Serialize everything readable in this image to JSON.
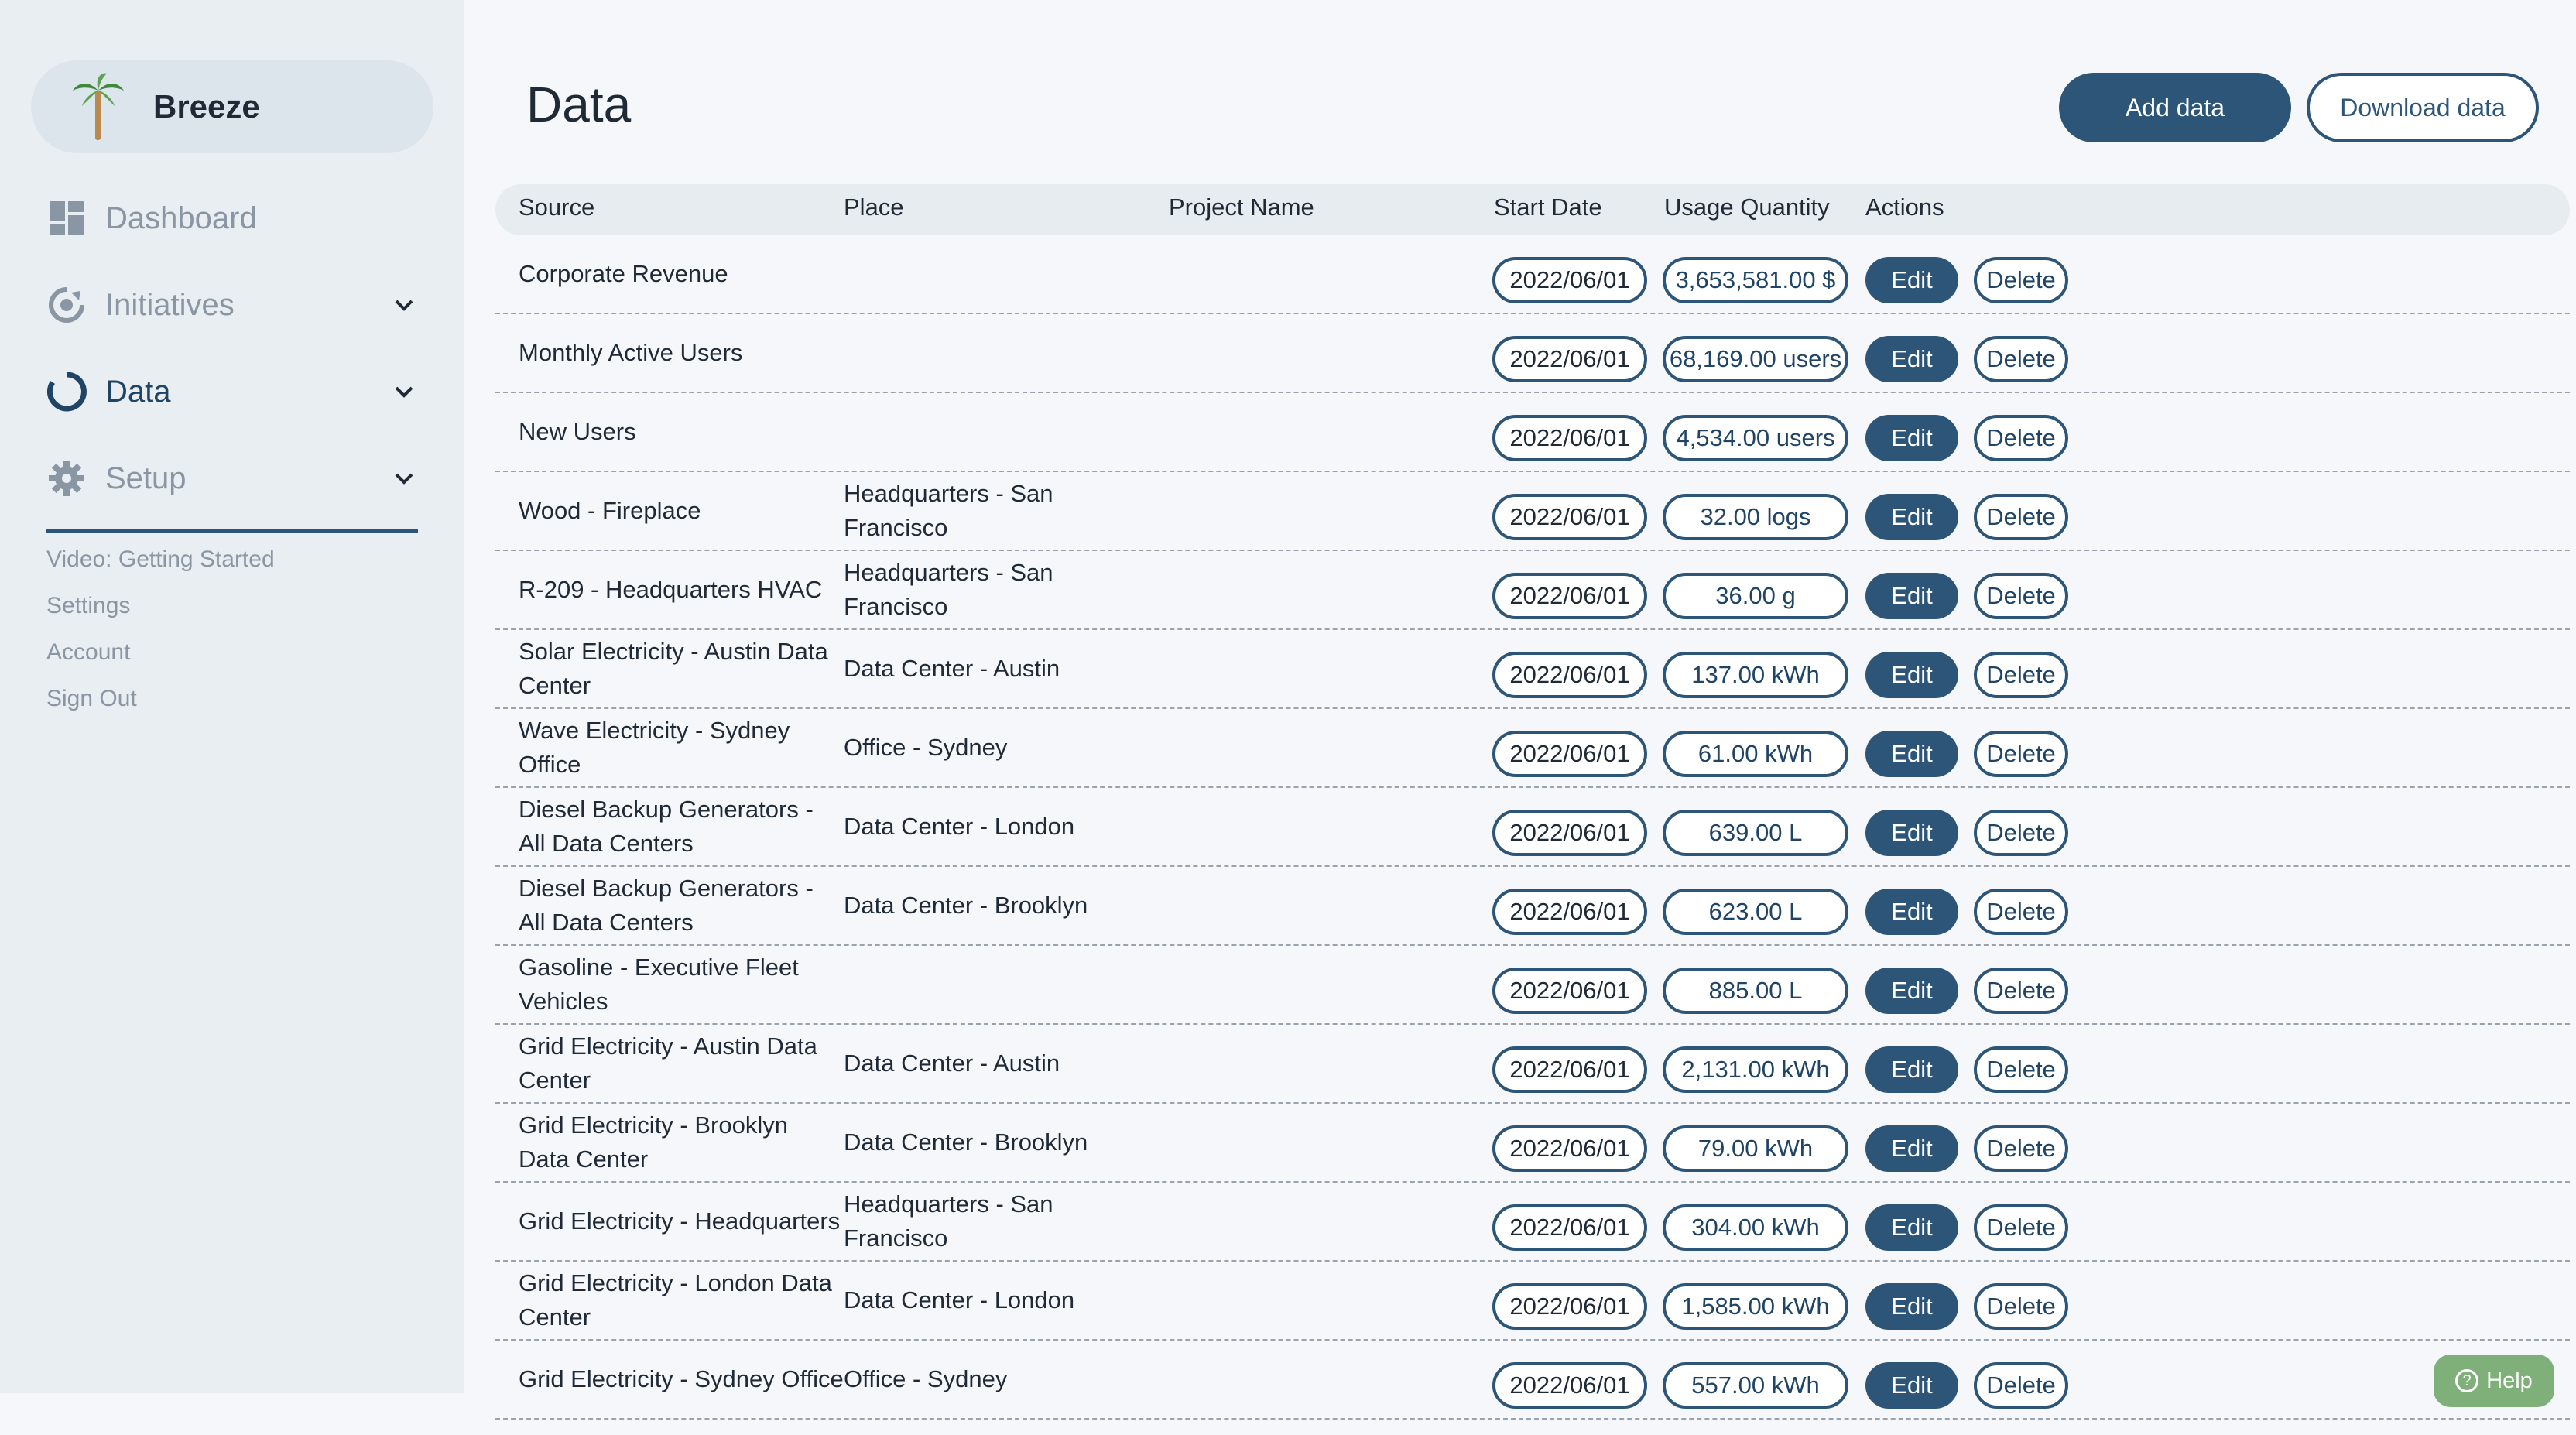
{
  "brand": {
    "name": "Breeze"
  },
  "nav": {
    "dashboard": "Dashboard",
    "initiatives": "Initiatives",
    "data": "Data",
    "setup": "Setup"
  },
  "side_links": [
    "Video: Getting Started",
    "Settings",
    "Account",
    "Sign Out"
  ],
  "page": {
    "title": "Data",
    "add_label": "Add data",
    "download_label": "Download data"
  },
  "table": {
    "headers": {
      "source": "Source",
      "place": "Place",
      "project": "Project Name",
      "start_date": "Start Date",
      "usage": "Usage Quantity",
      "actions": "Actions"
    },
    "edit_label": "Edit",
    "delete_label": "Delete",
    "rows": [
      {
        "source": "Corporate Revenue",
        "place": "",
        "date": "2022/06/01",
        "qty": "3,653,581.00 $"
      },
      {
        "source": "Monthly Active Users",
        "place": "",
        "date": "2022/06/01",
        "qty": "68,169.00 users"
      },
      {
        "source": "New Users",
        "place": "",
        "date": "2022/06/01",
        "qty": "4,534.00 users"
      },
      {
        "source": "Wood - Fireplace",
        "place": "Headquarters - San Francisco",
        "date": "2022/06/01",
        "qty": "32.00 logs"
      },
      {
        "source": "R-209 - Headquarters HVAC",
        "place": "Headquarters - San Francisco",
        "date": "2022/06/01",
        "qty": "36.00 g"
      },
      {
        "source": "Solar Electricity - Austin Data Center",
        "place": "Data Center - Austin",
        "date": "2022/06/01",
        "qty": "137.00 kWh"
      },
      {
        "source": "Wave Electricity - Sydney Office",
        "place": "Office - Sydney",
        "date": "2022/06/01",
        "qty": "61.00 kWh"
      },
      {
        "source": "Diesel Backup Generators - All Data Centers",
        "place": "Data Center - London",
        "date": "2022/06/01",
        "qty": "639.00 L"
      },
      {
        "source": "Diesel Backup Generators - All Data Centers",
        "place": "Data Center - Brooklyn",
        "date": "2022/06/01",
        "qty": "623.00 L"
      },
      {
        "source": "Gasoline - Executive Fleet Vehicles",
        "place": "",
        "date": "2022/06/01",
        "qty": "885.00 L"
      },
      {
        "source": "Grid Electricity - Austin Data Center",
        "place": "Data Center - Austin",
        "date": "2022/06/01",
        "qty": "2,131.00 kWh"
      },
      {
        "source": "Grid Electricity - Brooklyn Data Center",
        "place": "Data Center - Brooklyn",
        "date": "2022/06/01",
        "qty": "79.00 kWh"
      },
      {
        "source": "Grid Electricity - Headquarters",
        "place": "Headquarters - San Francisco",
        "date": "2022/06/01",
        "qty": "304.00 kWh"
      },
      {
        "source": "Grid Electricity - London Data Center",
        "place": "Data Center - London",
        "date": "2022/06/01",
        "qty": "1,585.00 kWh"
      },
      {
        "source": "Grid Electricity - Sydney Office",
        "place": "Office - Sydney",
        "date": "2022/06/01",
        "qty": "557.00 kWh"
      }
    ]
  },
  "help_label": "Help",
  "colors": {
    "accent": "#2c5578",
    "help": "#7fb07a",
    "sidebar_bg": "#e9eef3"
  },
  "icons": [
    "palm-tree-icon",
    "dashboard-icon",
    "initiatives-icon",
    "data-icon",
    "gear-icon",
    "chevron-down-icon",
    "help-icon"
  ]
}
